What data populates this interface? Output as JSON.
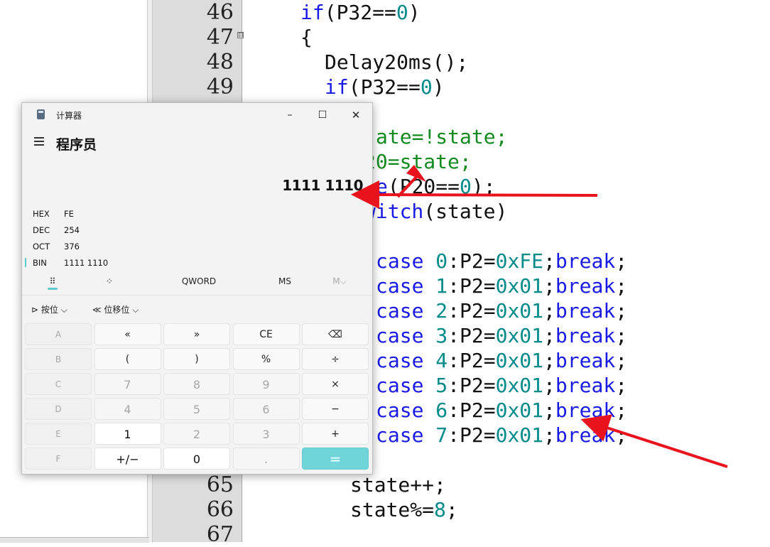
{
  "editor": {
    "line_numbers": [
      "46",
      "47",
      "48",
      "49",
      "65",
      "66",
      "67"
    ],
    "fold_marker": "⊟",
    "code": {
      "l46_kw": "if",
      "l46_rest_a": "(P32==",
      "l46_num": "0",
      "l46_rest_b": ")",
      "l47": "{",
      "l48": "Delay20ms();",
      "l49_kw": "if",
      "l49_rest_a": "(P32==",
      "l49_num": "0",
      "l49_rest_b": ")",
      "l51": "ate=!state;",
      "l52": "20=state;",
      "l53_kw": "e",
      "l53_rest_a": "(P20==",
      "l53_num": "0",
      "l53_rest_b": ");",
      "l54_kw": "witch",
      "l54_rest": "(state)",
      "cases": [
        {
          "kw": "case",
          "n": "0",
          "a": ":P2=",
          "v": "0xFE",
          "s": ";",
          "brk": "break",
          "e": ";"
        },
        {
          "kw": "case",
          "n": "1",
          "a": ":P2=",
          "v": "0x01",
          "s": ";",
          "brk": "break",
          "e": ";"
        },
        {
          "kw": "case",
          "n": "2",
          "a": ":P2=",
          "v": "0x01",
          "s": ";",
          "brk": "break",
          "e": ";"
        },
        {
          "kw": "case",
          "n": "3",
          "a": ":P2=",
          "v": "0x01",
          "s": ";",
          "brk": "break",
          "e": ";"
        },
        {
          "kw": "case",
          "n": "4",
          "a": ":P2=",
          "v": "0x01",
          "s": ";",
          "brk": "break",
          "e": ";"
        },
        {
          "kw": "case",
          "n": "5",
          "a": ":P2=",
          "v": "0x01",
          "s": ";",
          "brk": "break",
          "e": ";"
        },
        {
          "kw": "case",
          "n": "6",
          "a": ":P2=",
          "v": "0x01",
          "s": ";",
          "brk": "break",
          "e": ";"
        },
        {
          "kw": "case",
          "n": "7",
          "a": ":P2=",
          "v": "0x01",
          "s": ";",
          "brk": "break",
          "e": ";"
        }
      ],
      "l65": "state++;",
      "l66_a": "state%=",
      "l66_num": "8",
      "l66_b": ";"
    }
  },
  "calculator": {
    "window_title": "计算器",
    "controls": {
      "minimize": "–",
      "maximize": "☐",
      "close": "✕"
    },
    "mode": "程序员",
    "display": "1111 1110",
    "radix": [
      {
        "label": "HEX",
        "value": "FE"
      },
      {
        "label": "DEC",
        "value": "254"
      },
      {
        "label": "OCT",
        "value": "376"
      },
      {
        "label": "BIN",
        "value": "1111 1110"
      }
    ],
    "tools": {
      "keypad": "⠿",
      "bitflip": "⁘",
      "word_size": "QWORD",
      "ms": "MS",
      "mv": "M⌵"
    },
    "bitwise_label": "按位 ⌵",
    "bitshift_label": "位移位 ⌵",
    "keys": [
      [
        "A",
        "«",
        "»",
        "CE",
        "⌫"
      ],
      [
        "B",
        "(",
        ")",
        "%",
        "÷"
      ],
      [
        "C",
        "7",
        "8",
        "9",
        "×"
      ],
      [
        "D",
        "4",
        "5",
        "6",
        "−"
      ],
      [
        "E",
        "1",
        "2",
        "3",
        "+"
      ],
      [
        "F",
        "+/−",
        "0",
        ".",
        "="
      ]
    ]
  },
  "colors": {
    "accent": "#6fd5d8",
    "annotation": "#e8131c",
    "keyword": "#1a1ae6",
    "number": "#008a8a"
  }
}
